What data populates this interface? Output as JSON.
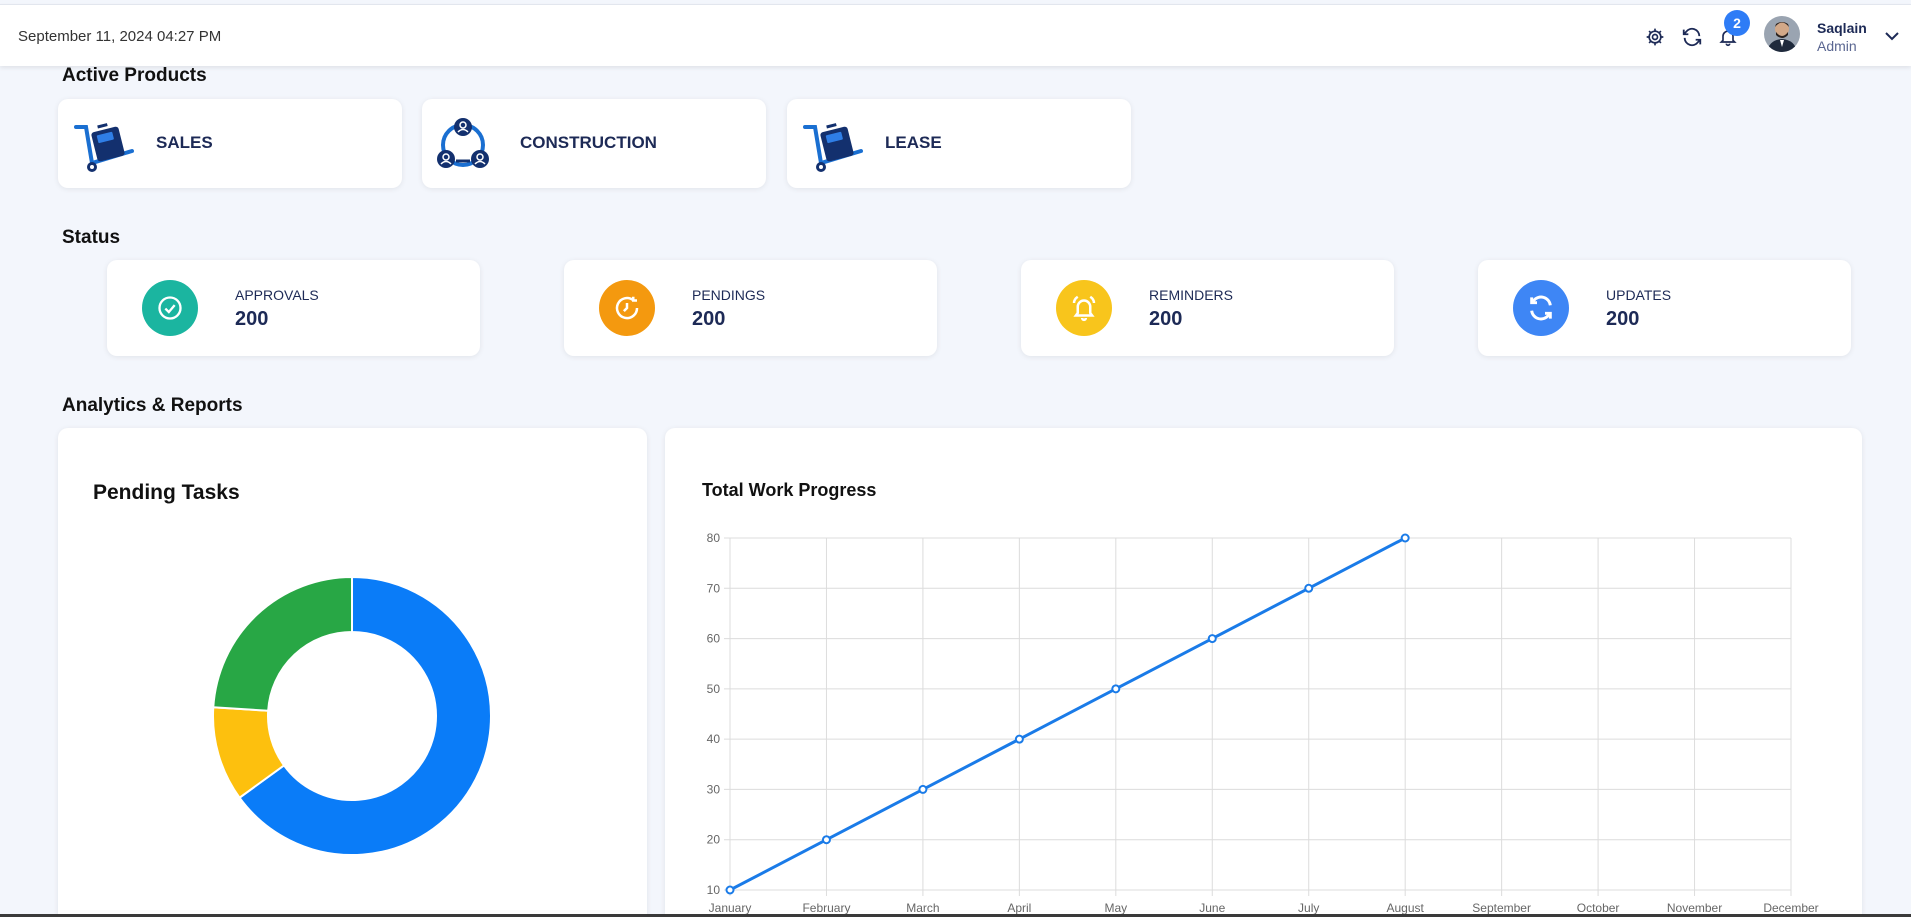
{
  "header": {
    "datetime": "September 11, 2024 04:27 PM",
    "notification_count": "2",
    "user": {
      "name": "Saqlain",
      "role": "Admin"
    },
    "icons": [
      "gear-icon",
      "refresh-icon",
      "bell-icon",
      "chevron-down-icon"
    ]
  },
  "sections": {
    "products": "Active Products",
    "status": "Status",
    "analytics": "Analytics & Reports"
  },
  "products": [
    {
      "label": "SALES",
      "icon": "hand-truck-box-icon"
    },
    {
      "label": "CONSTRUCTION",
      "icon": "team-network-icon"
    },
    {
      "label": "LEASE",
      "icon": "hand-truck-box-icon"
    }
  ],
  "status": [
    {
      "label": "APPROVALS",
      "value": "200",
      "color": "#1bb5a0",
      "icon": "check-circle-icon"
    },
    {
      "label": "PENDINGS",
      "value": "200",
      "color": "#f4990f",
      "icon": "clock-refresh-icon"
    },
    {
      "label": "REMINDERS",
      "value": "200",
      "color": "#f8c51c",
      "icon": "bell-ring-icon"
    },
    {
      "label": "UPDATES",
      "value": "200",
      "color": "#3e86f5",
      "icon": "sync-icon"
    }
  ],
  "pending_tasks": {
    "title": "Pending Tasks"
  },
  "work_progress": {
    "title": "Total Work Progress"
  },
  "chart_data": [
    {
      "type": "pie",
      "title": "Pending Tasks",
      "values": [
        65,
        11,
        24
      ],
      "colors": [
        "#0a7cf8",
        "#fdc00e",
        "#28a745"
      ]
    },
    {
      "type": "line",
      "title": "Total Work Progress",
      "categories": [
        "January",
        "February",
        "March",
        "April",
        "May",
        "June",
        "July",
        "August",
        "September",
        "October",
        "November",
        "December"
      ],
      "series": [
        {
          "values": [
            10,
            20,
            30,
            40,
            50,
            60,
            70,
            80
          ],
          "color": "#1a7be8"
        }
      ],
      "ylim": [
        10,
        80
      ],
      "yticks": [
        10,
        20,
        30,
        40,
        50,
        60,
        70,
        80
      ],
      "grid": true
    }
  ]
}
